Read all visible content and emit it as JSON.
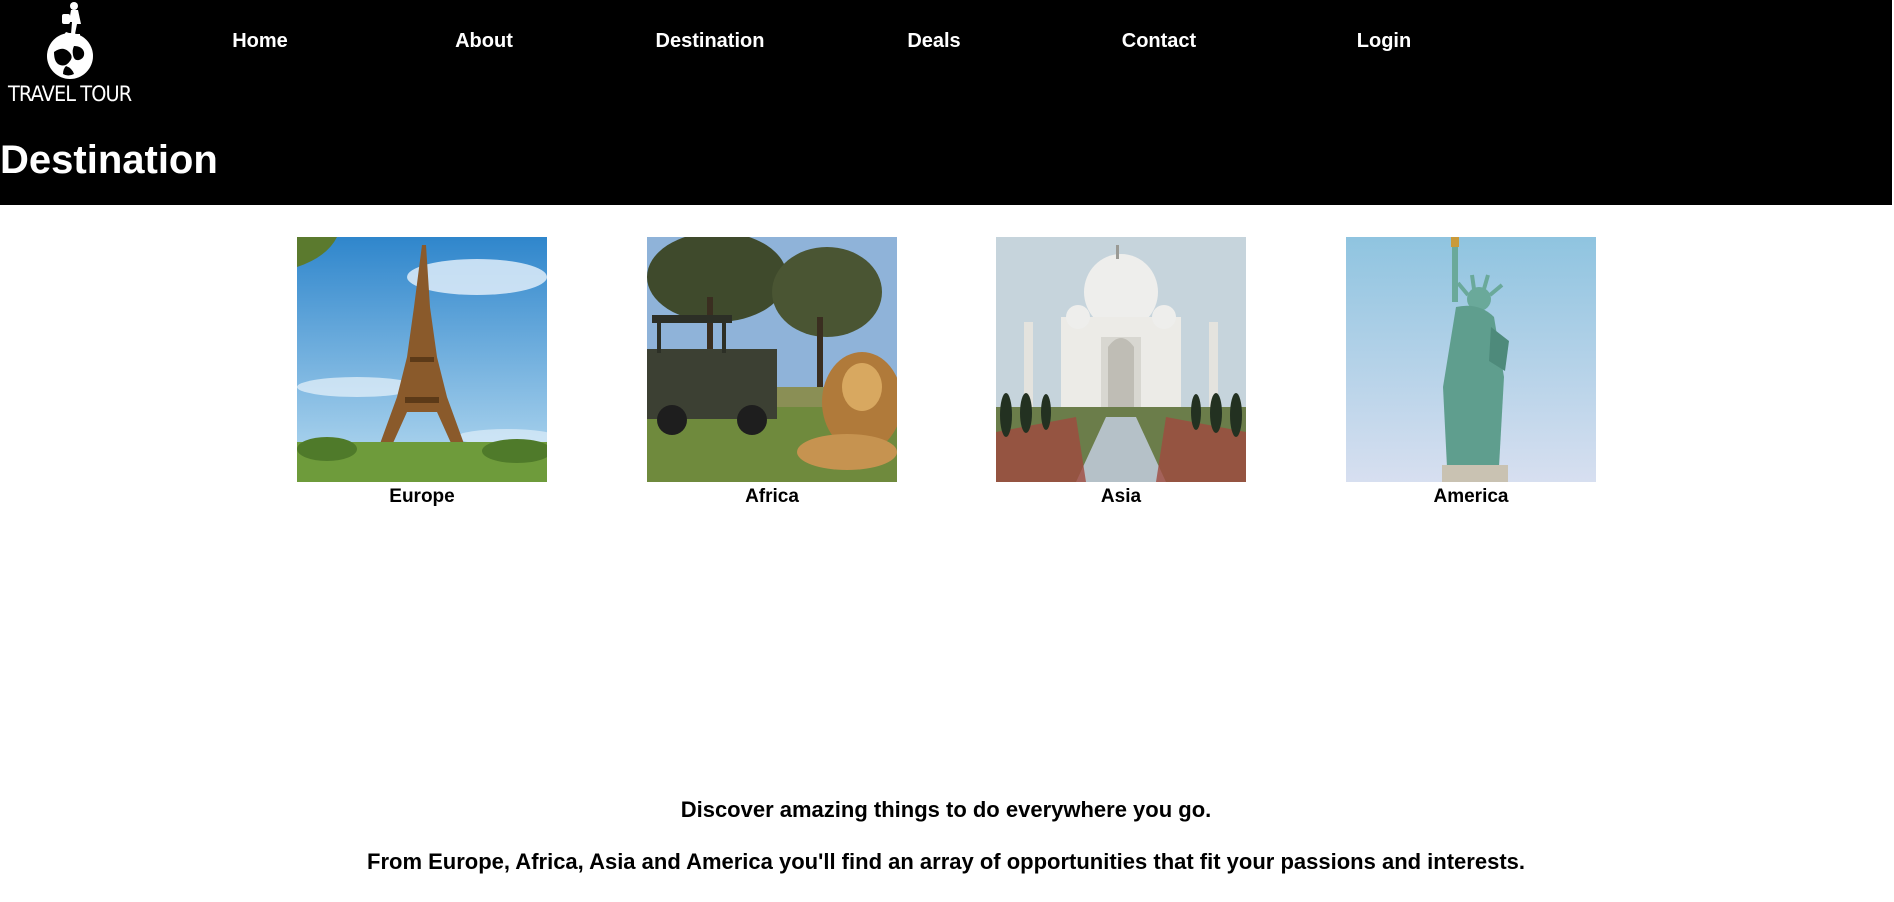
{
  "brand": {
    "name": "TRAVEL TOUR",
    "logo_icon": "traveler-on-globe-icon"
  },
  "nav": {
    "items": [
      {
        "label": "Home"
      },
      {
        "label": "About"
      },
      {
        "label": "Destination"
      },
      {
        "label": "Deals"
      },
      {
        "label": "Contact"
      },
      {
        "label": "Login"
      }
    ]
  },
  "page": {
    "title": "Destination"
  },
  "destinations": [
    {
      "label": "Europe",
      "image": "eiffel-tower-photo"
    },
    {
      "label": "Africa",
      "image": "lion-safari-photo"
    },
    {
      "label": "Asia",
      "image": "taj-mahal-photo"
    },
    {
      "label": "America",
      "image": "statue-of-liberty-photo"
    }
  ],
  "tagline": {
    "line1": "Discover amazing things to do everywhere you go.",
    "line2": "From Europe, Africa, Asia and America you'll find an array of opportunities that fit your passions and interests."
  },
  "colors": {
    "header_bg": "#000000",
    "header_text": "#ffffff",
    "body_text": "#000000"
  }
}
